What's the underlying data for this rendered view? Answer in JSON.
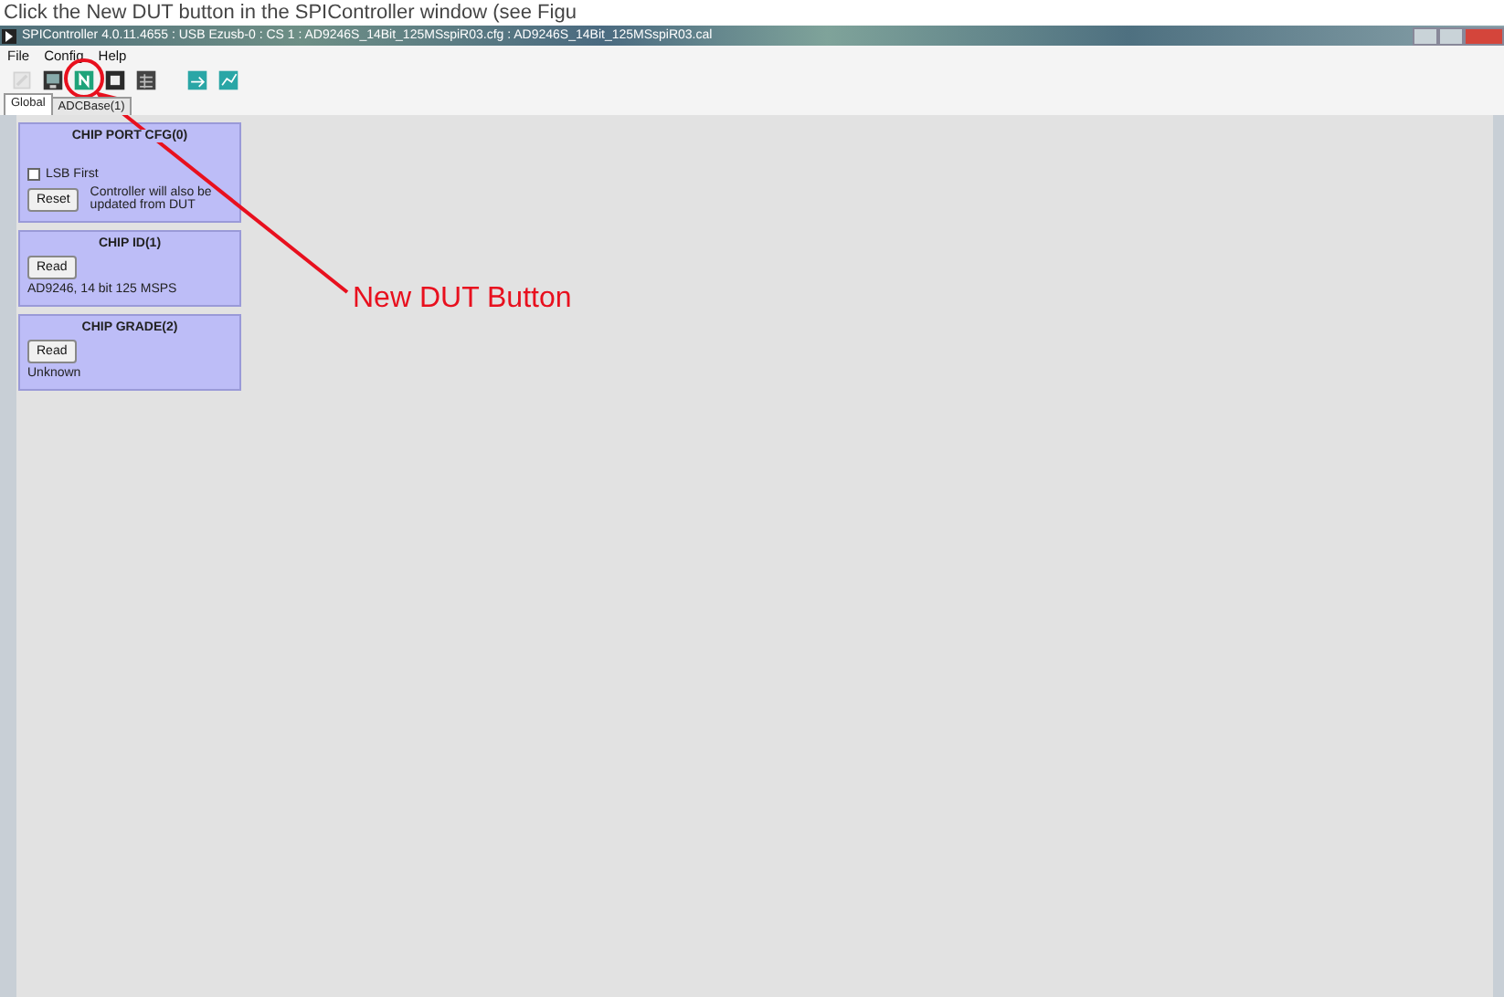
{
  "caption": "Click the New DUT button in the SPIController window (see Figu",
  "window": {
    "title": "SPIController 4.0.11.4655 : USB Ezusb-0 : CS 1 : AD9246S_14Bit_125MSspiR03.cfg : AD9246S_14Bit_125MSspiR03.cal"
  },
  "menu": [
    "File",
    "Config",
    "Help"
  ],
  "toolbar": [
    {
      "kind": "pencil",
      "disabled": true
    },
    {
      "kind": "monitor",
      "disabled": false
    },
    {
      "kind": "new",
      "disabled": false
    },
    {
      "kind": "square",
      "disabled": false
    },
    {
      "kind": "grid",
      "disabled": false
    },
    {
      "kind": "chart-in",
      "disabled": false
    },
    {
      "kind": "chart-out",
      "disabled": false
    }
  ],
  "tabs": [
    {
      "label": "Global",
      "selected": true
    },
    {
      "label": "ADCBase(1)",
      "selected": false
    }
  ],
  "panels": [
    {
      "title": "CHIP PORT CFG(0)",
      "checkbox": {
        "label": "LSB First",
        "checked": false
      },
      "button": "Reset",
      "note": "Controller will also be updated from DUT"
    },
    {
      "title": "CHIP ID(1)",
      "button": "Read",
      "value": "AD9246, 14 bit 125 MSPS"
    },
    {
      "title": "CHIP GRADE(2)",
      "button": "Read",
      "value": "Unknown"
    }
  ],
  "annotation": {
    "label": "New DUT Button"
  }
}
